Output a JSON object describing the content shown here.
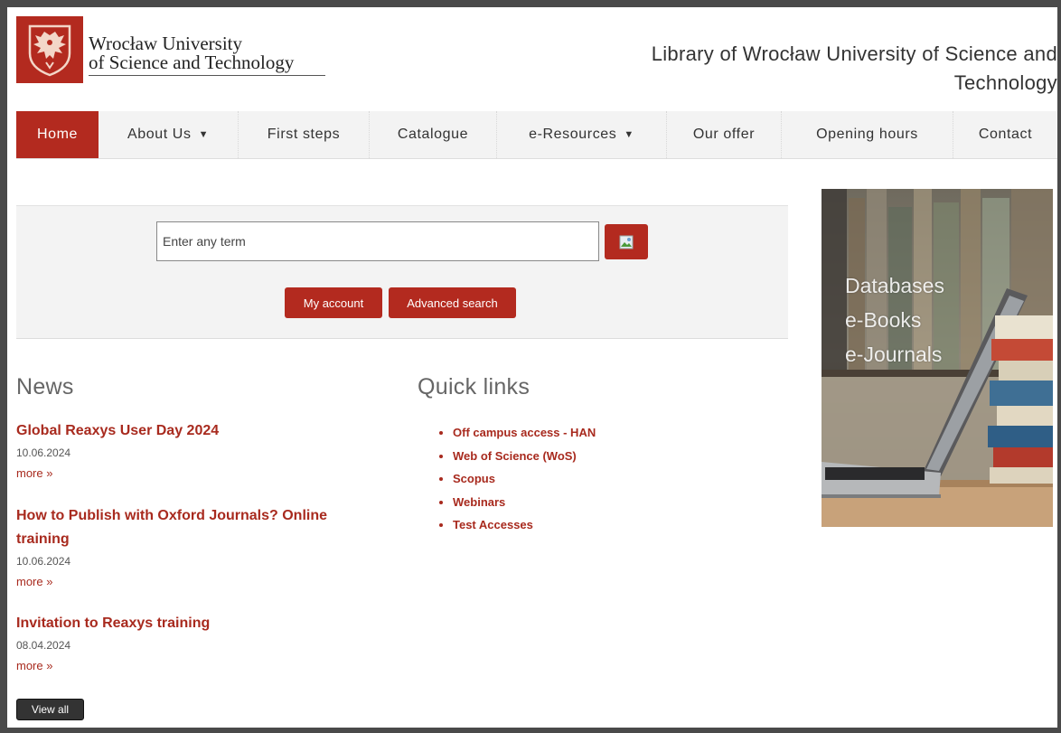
{
  "header": {
    "university_line1": "Wrocław University",
    "university_line2": "of Science and Technology",
    "library_title": "Library of Wrocław University of Science and Technology"
  },
  "nav": {
    "items": [
      {
        "label": "Home",
        "active": true,
        "dropdown": false
      },
      {
        "label": "About Us",
        "active": false,
        "dropdown": true
      },
      {
        "label": "First steps",
        "active": false,
        "dropdown": false
      },
      {
        "label": "Catalogue",
        "active": false,
        "dropdown": false
      },
      {
        "label": "e-Resources",
        "active": false,
        "dropdown": true
      },
      {
        "label": "Our offer",
        "active": false,
        "dropdown": false
      },
      {
        "label": "Opening hours",
        "active": false,
        "dropdown": false
      },
      {
        "label": "Contact",
        "active": false,
        "dropdown": false
      }
    ],
    "caret_icon": "▼"
  },
  "search": {
    "placeholder": "Enter any term",
    "search_icon": "broken-image-icon",
    "my_account_label": "My account",
    "advanced_label": "Advanced search"
  },
  "news": {
    "title": "News",
    "items": [
      {
        "title": "Global Reaxys User Day 2024",
        "date": "10.06.2024",
        "more": "more »"
      },
      {
        "title": "How to Publish with Oxford Journals? Online training",
        "date": "10.06.2024",
        "more": "more »"
      },
      {
        "title": "Invitation to Reaxys training",
        "date": "08.04.2024",
        "more": "more »"
      }
    ],
    "view_all_label": "View all"
  },
  "quick_links": {
    "title": "Quick links",
    "items": [
      "Off campus access - HAN",
      "Web of Science (WoS)",
      "Scopus",
      "Webinars",
      "Test Accesses"
    ]
  },
  "banner": {
    "lines": [
      "Databases",
      "e-Books",
      "e-Journals"
    ]
  },
  "colors": {
    "brand_red": "#b32a1f",
    "link_red": "#a82a1e",
    "panel_gray": "#f3f3f3"
  }
}
